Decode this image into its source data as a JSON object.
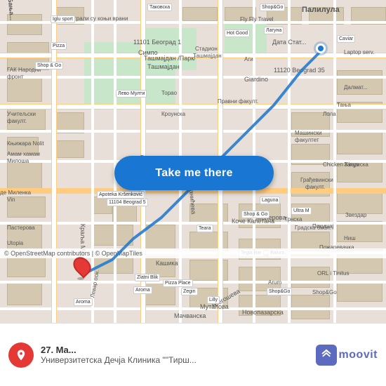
{
  "map": {
    "attribution": "© OpenStreetMap contributors | © OpenMapTiles",
    "center_lat": 44.81,
    "center_lng": 20.47
  },
  "button": {
    "label": "Take me there"
  },
  "bottom_bar": {
    "from_label": "27. Ma...",
    "to_label": "Универзитетска Дечја Клиника \"\"Тирш...",
    "logo_letter": "m",
    "logo_text": "moovit"
  },
  "icons": {
    "location_pin": "📍",
    "blue_dot": "●"
  },
  "colors": {
    "button_bg": "#1976d2",
    "pin_color": "#e53935",
    "logo_color": "#5c6bc0",
    "road_main": "#ffcc80",
    "road_secondary": "#ffffff",
    "map_bg": "#e8e0d8",
    "green_area": "#c8e6c9"
  }
}
